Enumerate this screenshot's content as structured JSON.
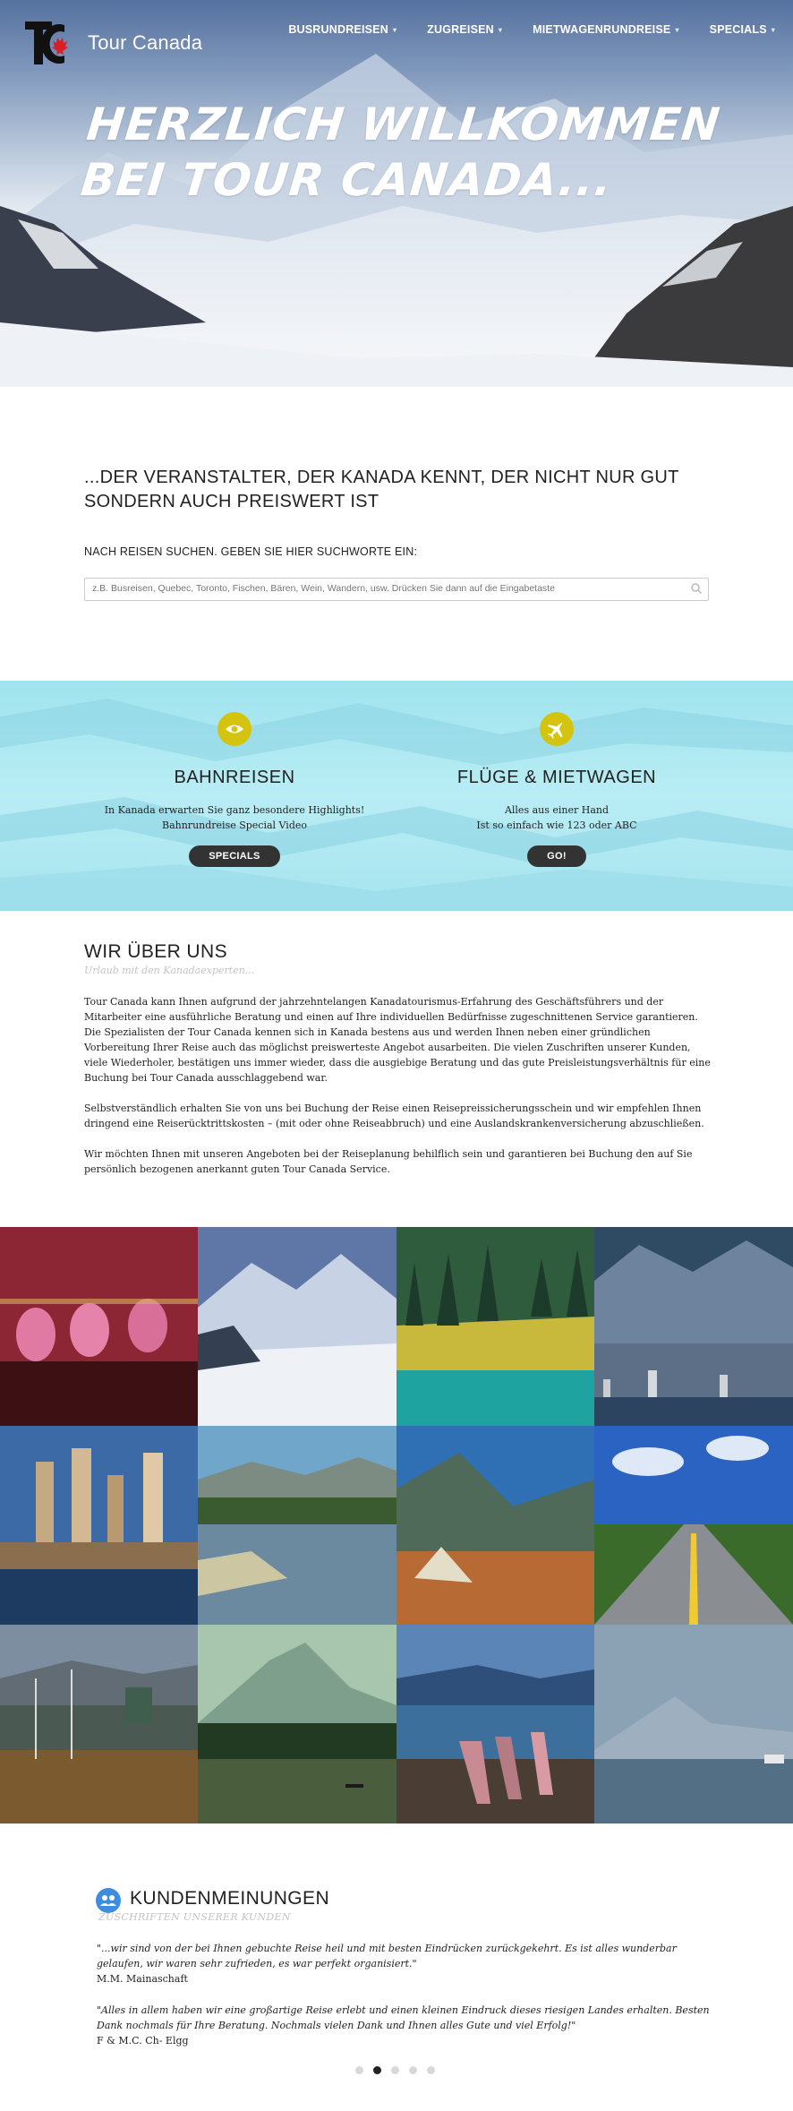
{
  "brand": {
    "name": "Tour Canada",
    "accent": "#d91f26"
  },
  "nav": {
    "items": [
      {
        "label": "BUSRUNDREISEN"
      },
      {
        "label": "ZUGREISEN"
      },
      {
        "label": "MIETWAGENRUNDREISE"
      },
      {
        "label": "SPECIALS"
      }
    ]
  },
  "hero": {
    "line1": "HERZLICH WILLKOMMEN",
    "line2": "BEI TOUR CANADA..."
  },
  "intro": {
    "tagline": "...DER VERANSTALTER, DER KANADA KENNT, DER NICHT NUR GUT SONDERN AUCH PREISWERT IST",
    "search_label": "NACH REISEN SUCHEN. GEBEN SIE HIER SUCHWORTE EIN:",
    "search_placeholder": "z.B. Busreisen, Quebec, Toronto, Fischen, Bären, Wein, Wandern, usw. Drücken Sie dann auf die Eingabetaste"
  },
  "features": [
    {
      "icon": "eye-icon",
      "title": "BAHNREISEN",
      "line1": "In Kanada erwarten Sie ganz besondere Highlights!",
      "line2": "Bahnrundreise Special Video",
      "button": "SPECIALS"
    },
    {
      "icon": "airplane-icon",
      "title": "FLÜGE & MIETWAGEN",
      "line1": "Alles aus einer Hand",
      "line2": "Ist so einfach wie 123 oder ABC",
      "button": "GO!"
    }
  ],
  "about": {
    "title": "WIR ÜBER UNS",
    "subtitle": "Urlaub mit den Kanadaexperten...",
    "p1": "Tour Canada kann Ihnen aufgrund der jahrzehntelangen Kanadatourismus-Erfahrung des Geschäftsführers und der Mitarbeiter eine ausführliche Beratung und einen auf Ihre individuellen Bedürfnisse zugeschnittenen Service garantieren. Die Spezialisten der Tour Canada kennen sich in Kanada bestens aus und werden Ihnen neben einer gründlichen Vorbereitung Ihrer Reise auch das möglichst preiswerteste Angebot ausarbeiten. Die vielen Zuschriften unserer Kunden, viele Wiederholer, bestätigen uns immer wieder, dass die ausgiebige Beratung und das gute Preisleistungsverhältnis für eine Buchung bei Tour Canada ausschlaggebend war.",
    "p2": "Selbstverständlich erhalten Sie von uns bei Buchung der Reise einen Reisepreissicherungsschein und wir empfehlen Ihnen dringend eine Reiserücktrittskosten – (mit oder ohne Reiseabbruch) und eine Auslandskrankenversicherung abzuschließen.",
    "p3": "Wir möchten Ihnen mit unseren Angeboten bei der Reiseplanung behilflich sein und garantieren bei Buchung den auf Sie persönlich bezogenen anerkannt guten Tour Canada Service."
  },
  "testimonials": {
    "title": "KUNDENMEINUNGEN",
    "subtitle": "ZUSCHRIFTEN UNSERER KUNDEN",
    "items": [
      {
        "quote": "\"...wir sind von der bei Ihnen gebuchte Reise heil und mit besten Eindrücken zurückgekehrt. Es ist alles wunderbar gelaufen, wir waren sehr zufrieden, es war perfekt organisiert.\"",
        "author": "M.M. Mainaschaft"
      },
      {
        "quote": "\"Alles in allem haben wir eine großartige Reise erlebt und einen kleinen Eindruck dieses riesigen Landes erhalten. Besten Dank nochmals für Ihre Beratung. Nochmals vielen Dank und Ihnen alles Gute und viel Erfolg!\"",
        "author": "F & M.C. Ch- Elgg"
      }
    ],
    "slides": 5,
    "active_slide": 2
  }
}
